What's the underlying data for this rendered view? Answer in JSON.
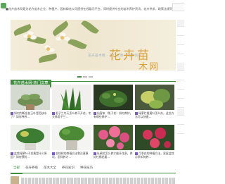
{
  "header": {
    "intro": "■花卉苗木网是为花卉苗木企业、种植户、园林绿化公司提供在线展示平台，同时提供专业的苗木养护资讯、花卉供求、政策法规等信息服务。"
  },
  "banner": {
    "title_top": "花卉苗",
    "title_bottom": "木网",
    "subtitle": "花卉苗木网  ·  热门文章  ·  苗木资讯"
  },
  "hot_section": {
    "title": "花卉苗木网-热门文章"
  },
  "articles": [
    {
      "caption": "如何判断金枝玉叶是否缺水了？如何种养…"
    },
    {
      "caption": "君子兰冬天怎么养不开花，冬天养君子兰…"
    },
    {
      "caption": "仙客来（兔子花）如何养护，有哪些养护…"
    },
    {
      "caption": "绿萝烂根黄叶怎么办，这些方法可以快速…"
    },
    {
      "caption": "盆栽绿萝叶子发黄是什么原因？如何预防…"
    },
    {
      "caption": "金钱树的养殖方法和注意事项，怎样养才…"
    },
    {
      "caption": "杜鹃花怎么养才能开花多，养好杜鹃花要…"
    },
    {
      "caption": "月季花的种植方法，家庭盆栽月季如何养…"
    }
  ],
  "tabs": [
    "全部",
    "花卉养殖",
    "苗木大全",
    "养花知识",
    "种花技巧"
  ],
  "colors": {
    "accent": "#3e8e3e",
    "banner_text": "#d8a13b",
    "icon": "#7b5cc4"
  }
}
